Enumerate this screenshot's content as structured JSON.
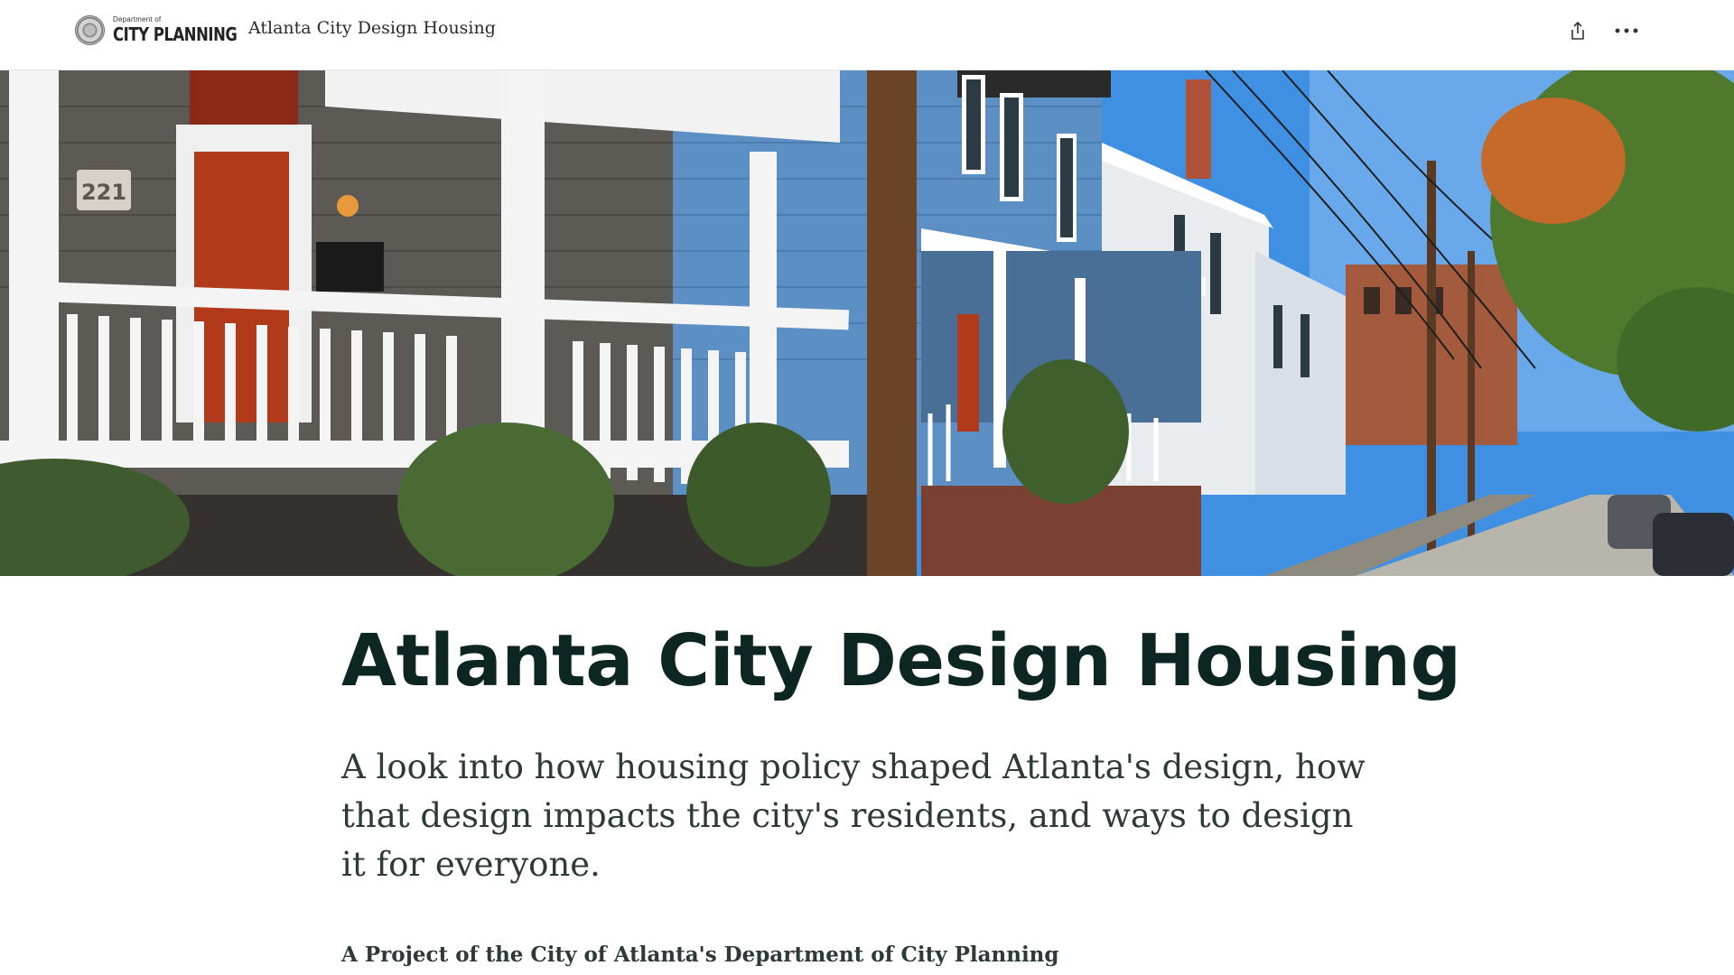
{
  "header": {
    "logo_small": "Department of",
    "logo_big": "CITY PLANNING",
    "title": "Atlanta City Design Housing",
    "share_icon": "share-icon",
    "more_icon": "more-horizontal-icon"
  },
  "hero": {
    "house_number": "221",
    "sky_color": "#3f8fe3"
  },
  "main": {
    "title": "Atlanta City Design Housing",
    "subtitle": "A look into how housing policy shaped Atlanta's design, how that design impacts the city's residents, and ways to design it for everyone.",
    "byline": "A Project of the City of Atlanta's Department of City Planning"
  }
}
